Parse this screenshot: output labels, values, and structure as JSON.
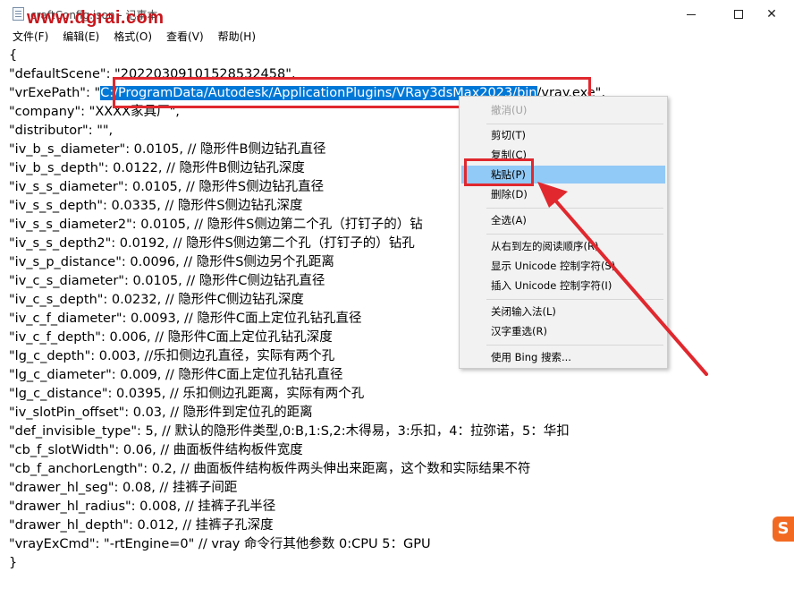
{
  "window": {
    "title": "craftConfig.json - 记事本",
    "watermark": "www.dgrai.com",
    "minimize_glyph": "—",
    "maximize_glyph": "☐",
    "close_glyph": "✕"
  },
  "menu": {
    "items": [
      "文件(F)",
      "编辑(E)",
      "格式(O)",
      "查看(V)",
      "帮助(H)"
    ]
  },
  "editor": {
    "selected_text": "C:/ProgramData/Autodesk/ApplicationPlugins/VRay3dsMax2023/bin",
    "lines": [
      "{",
      "    \"defaultScene\": \"20220309101528532458\",",
      "    \"vrExePath\": \"",
      "    \"company\": \"XXXX家具厂\",",
      "    \"distributor\": \"\",",
      "    \"iv_b_s_diameter\": 0.0105, // 隐形件B侧边钻孔直径",
      "    \"iv_b_s_depth\": 0.0122, // 隐形件B侧边钻孔深度",
      "    \"iv_s_s_diameter\": 0.0105, // 隐形件S侧边钻孔直径",
      "    \"iv_s_s_depth\": 0.0335, // 隐形件S侧边钻孔深度",
      "    \"iv_s_s_diameter2\": 0.0105, // 隐形件S侧边第二个孔（打钉子的）钻",
      "    \"iv_s_s_depth2\": 0.0192, // 隐形件S侧边第二个孔（打钉子的）钻孔",
      "    \"iv_s_p_distance\": 0.0096, // 隐形件S侧边另个孔距离",
      "    \"iv_c_s_diameter\": 0.0105, // 隐形件C侧边钻孔直径",
      "    \"iv_c_s_depth\": 0.0232, // 隐形件C侧边钻孔深度",
      "    \"iv_c_f_diameter\": 0.0093, // 隐形件C面上定位孔钻孔直径",
      "    \"iv_c_f_depth\": 0.006, // 隐形件C面上定位孔钻孔深度",
      "    \"lg_c_depth\": 0.003, //乐扣侧边孔直径，实际有两个孔",
      "    \"lg_c_diameter\": 0.009, // 隐形件C面上定位孔钻孔直径",
      "    \"lg_c_distance\": 0.0395, // 乐扣侧边孔距离，实际有两个孔",
      "    \"iv_slotPin_offset\": 0.03, // 隐形件到定位孔的距离",
      "    \"def_invisible_type\": 5, // 默认的隐形件类型,0:B,1:S,2:木得易，3:乐扣，4：拉弥诺，5：华扣",
      "    \"cb_f_slotWidth\": 0.06, // 曲面板件结构板件宽度",
      "    \"cb_f_anchorLength\": 0.2, // 曲面板件结构板件两头伸出来距离，这个数和实际结果不符",
      "    \"drawer_hl_seg\": 0.08, // 挂裤子间距",
      "    \"drawer_hl_radius\": 0.008, // 挂裤子孔半径",
      "    \"drawer_hl_depth\": 0.012, // 挂裤子孔深度",
      "    \"vrayExCmd\": \"-rtEngine=0\" // vray 命令行其他参数 0:CPU    5：GPU",
      "}"
    ],
    "path_tail": "/vray.exe\","
  },
  "context_menu": {
    "items": [
      {
        "label": "撤消(U)",
        "disabled": true
      },
      {
        "label": "剪切(T)",
        "disabled": false
      },
      {
        "label": "复制(C)",
        "disabled": false
      },
      {
        "label": "粘贴(P)",
        "disabled": false,
        "active": true
      },
      {
        "label": "删除(D)",
        "disabled": false
      },
      {
        "label": "全选(A)",
        "disabled": false
      },
      {
        "label": "从右到左的阅读顺序(R)",
        "disabled": false
      },
      {
        "label": "显示 Unicode 控制字符(S)",
        "disabled": false
      },
      {
        "label": "插入 Unicode 控制字符(I)",
        "disabled": false,
        "submenu": true
      },
      {
        "label": "关闭输入法(L)",
        "disabled": false
      },
      {
        "label": "汉字重选(R)",
        "disabled": false
      },
      {
        "label": "使用 Bing 搜索...",
        "disabled": false
      }
    ]
  },
  "badge": {
    "label": "S"
  },
  "colors": {
    "selection": "#0078d7",
    "annotation_red": "#e0282e",
    "menu_hover": "#91c9f7"
  }
}
